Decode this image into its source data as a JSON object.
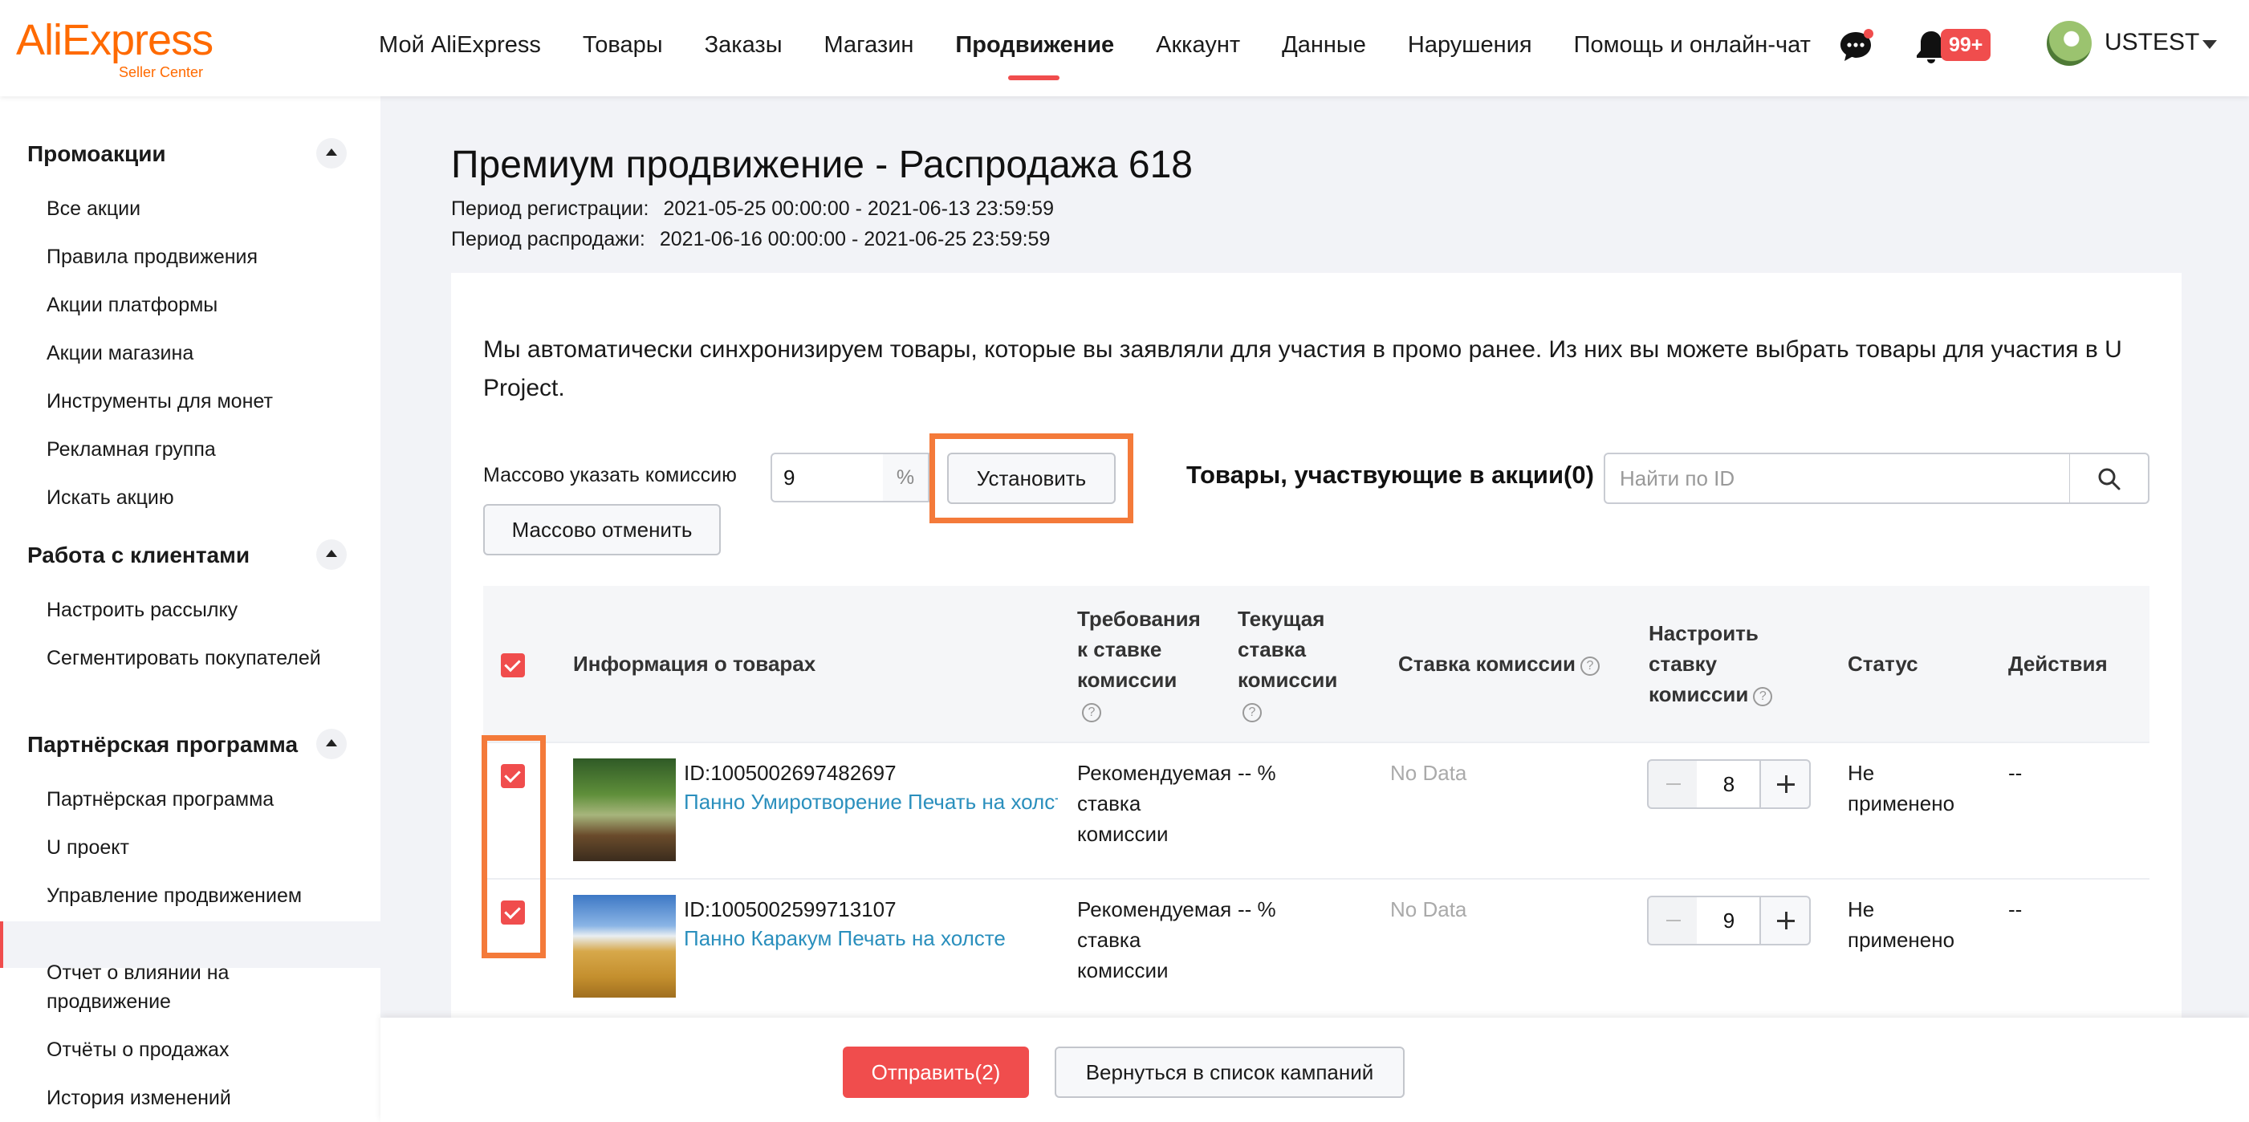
{
  "brand": {
    "logo": "AliExpress",
    "subtitle": "Seller Center",
    "color": "#ff6a00",
    "accent": "#f04d4d"
  },
  "nav": {
    "items": [
      {
        "label": "Мой AliExpress"
      },
      {
        "label": "Товары"
      },
      {
        "label": "Заказы"
      },
      {
        "label": "Магазин"
      },
      {
        "label": "Продвижение",
        "active": true
      },
      {
        "label": "Аккаунт"
      },
      {
        "label": "Данные"
      },
      {
        "label": "Нарушения"
      },
      {
        "label": "Помощь и онлайн-чат"
      }
    ],
    "chat_icon": "chat-bubble-icon",
    "bell_icon": "bell-icon",
    "notification_count": "99+",
    "user_name": "USTEST"
  },
  "sidebar": {
    "groups": [
      {
        "title": "Промоакции",
        "items": [
          "Все акции",
          "Правила продвижения",
          "Акции платформы",
          "Акции магазина",
          "Инструменты для монет",
          "Рекламная группа",
          "Искать акцию"
        ]
      },
      {
        "title": "Работа с клиентами",
        "items": [
          "Настроить рассылку",
          "Сегментировать покупателей"
        ]
      },
      {
        "title": "Партнёрская программа",
        "items": [
          "Партнёрская программа",
          "U проект",
          "Управление продвижением",
          "Отчет о влиянии на продвижение",
          "Отчёты о продажах",
          "История изменений"
        ]
      }
    ],
    "active_item": "U проект"
  },
  "page": {
    "title": "Премиум продвижение - Распродажа 618",
    "registration_label": "Период регистрации:",
    "registration_value": "2021-05-25 00:00:00 - 2021-06-13 23:59:59",
    "sale_label": "Период распродажи:",
    "sale_value": "2021-06-16 00:00:00 - 2021-06-25 23:59:59",
    "intro": "Мы автоматически синхронизируем товары, которые вы заявляли для участия в промо ранее. Из них вы можете выбрать товары для участия в U Project."
  },
  "bulk": {
    "label": "Массово указать комиссию",
    "value": "9",
    "suffix": "%",
    "set_button": "Установить",
    "cancel_button": "Массово отменить"
  },
  "participating": {
    "label": "Товары, участвующие в акции(0)"
  },
  "search": {
    "placeholder": "Найти по ID"
  },
  "table": {
    "headers": {
      "info": "Информация о товарах",
      "requirement": "Требования к ставке комиссии",
      "current": "Текущая ставка комиссии",
      "rate": "Ставка комиссии",
      "adjust": "Настроить ставку комиссии",
      "status": "Статус",
      "actions": "Действия"
    },
    "rows": [
      {
        "id": "ID:1005002697482697",
        "name": "Панно Умиротворение Печать на холсте",
        "requirement": "Рекомендуемая ставка комиссии",
        "current": "-- %",
        "rate": "No Data",
        "adjust": "8",
        "status": "Не применено",
        "actions": "--",
        "checked": true
      },
      {
        "id": "ID:1005002599713107",
        "name": "Панно Каракум Печать на холсте",
        "requirement": "Рекомендуемая ставка комиссии",
        "current": "-- %",
        "rate": "No Data",
        "adjust": "9",
        "status": "Не применено",
        "actions": "--",
        "checked": true
      }
    ]
  },
  "footer": {
    "submit": "Отправить(2)",
    "back": "Вернуться в список кампаний"
  }
}
